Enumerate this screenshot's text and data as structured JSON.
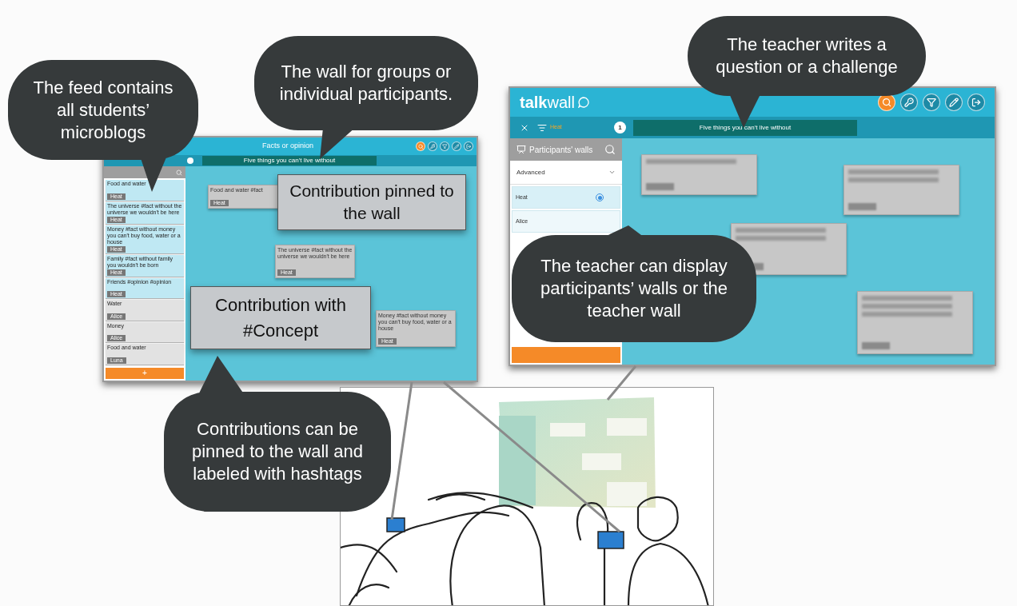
{
  "callouts": [
    {
      "text": "The feed contains all students’ microblogs"
    },
    {
      "text": "The wall for groups or individual participants."
    },
    {
      "text": "The teacher writes a question or a challenge"
    },
    {
      "text": "The teacher can display participants’ walls or the teacher wall"
    },
    {
      "text": "Contributions can be pinned to the wall and labeled with hashtags"
    }
  ],
  "labels": [
    "Contribution pinned to the wall",
    "Contribution with #Concept"
  ],
  "student_screen": {
    "title": "Facts or opinion",
    "question": "Five things you can't live without",
    "feed": [
      {
        "text": "Food and water",
        "tag": "Heat",
        "highlighted": true
      },
      {
        "text": "The universe #fact without the universe we wouldn't be here",
        "tag": "Heat",
        "highlighted": true
      },
      {
        "text": "Money #fact without money you can't buy food, water or a house",
        "tag": "Heat",
        "highlighted": true
      },
      {
        "text": "Family #fact without family you wouldn't be born",
        "tag": "Heat",
        "highlighted": true
      },
      {
        "text": "Friends #opinion #opinion",
        "tag": "Heat",
        "highlighted": true
      },
      {
        "text": "Water",
        "tag": "Alice",
        "highlighted": false
      },
      {
        "text": "Money",
        "tag": "Alice",
        "highlighted": false
      },
      {
        "text": "Food and water",
        "tag": "Luna",
        "highlighted": false
      }
    ],
    "wall_cards": [
      {
        "text": "Food and water #fact",
        "tag": "Heat"
      },
      {
        "text": "The universe #fact without the universe we wouldn't be here",
        "tag": "Heat"
      },
      {
        "text": "Money #fact without money you can't buy food, water or a house",
        "tag": "Heat"
      }
    ],
    "add_button": "+"
  },
  "teacher_screen": {
    "logo_bold": "talk",
    "logo_rest": "wall",
    "nav_label": "Heat",
    "question_number": "1",
    "question": "Five things you can't live without",
    "panel_title": "Participants' walls",
    "dropdown": "Advanced",
    "participants": [
      {
        "name": "Heat",
        "selected": true
      },
      {
        "name": "Alice",
        "selected": false
      }
    ]
  }
}
